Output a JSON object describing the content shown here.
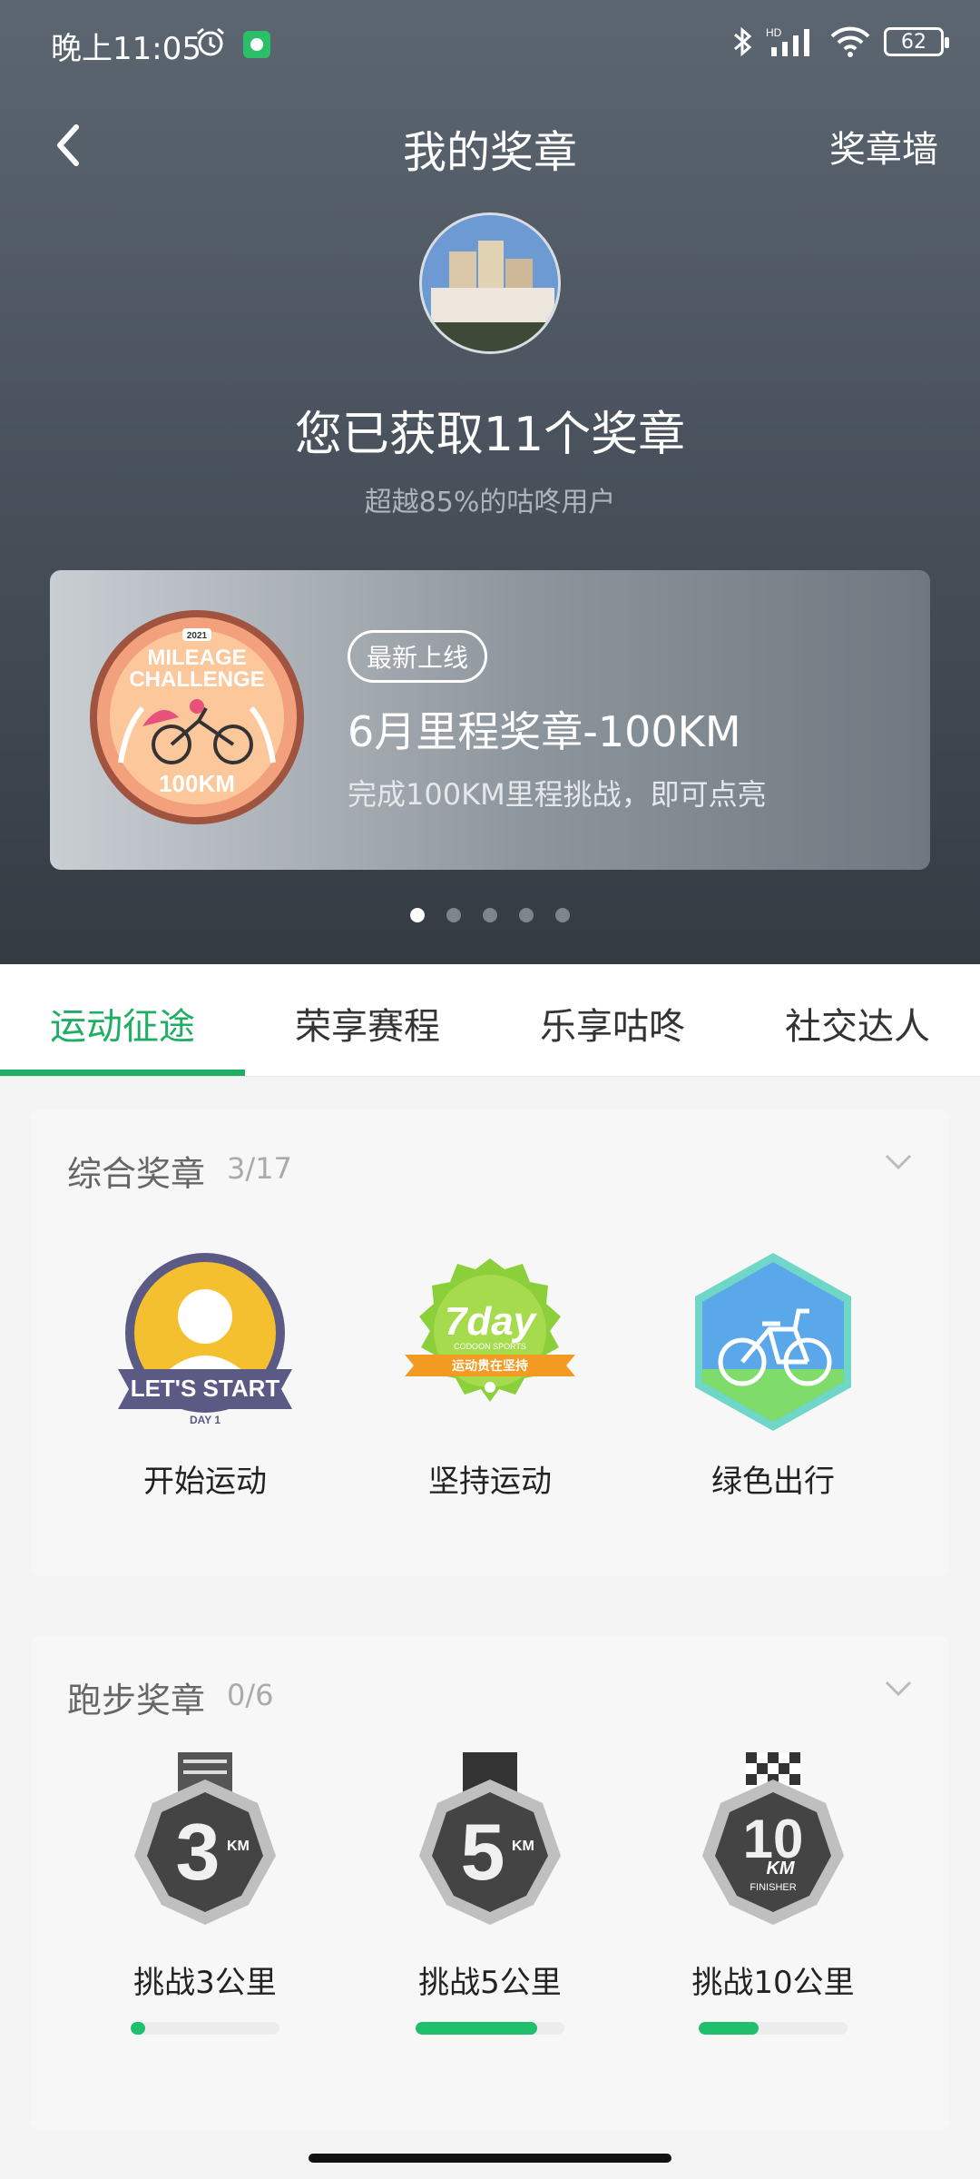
{
  "status_bar": {
    "time": "晚上11:05",
    "battery": "62",
    "hd": "HD"
  },
  "nav": {
    "title": "我的奖章",
    "right_action": "奖章墙"
  },
  "summary": {
    "heading": "您已获取11个奖章",
    "subheading": "超越85%的咕咚用户"
  },
  "banner": {
    "tag": "最新上线",
    "title": "6月里程奖章-100KM",
    "description": "完成100KM里程挑战，即可点亮",
    "medal_text": {
      "year": "2021",
      "line1": "MILEAGE",
      "line2": "CHALLENGE",
      "distance": "100KM"
    }
  },
  "carousel": {
    "count": 5,
    "active": 0
  },
  "tabs": [
    "运动征途",
    "荣享赛程",
    "乐享咕咚",
    "社交达人"
  ],
  "active_tab": 0,
  "sections": [
    {
      "title": "综合奖章",
      "count": "3/17",
      "badges": [
        {
          "label": "开始运动",
          "art": {
            "line1": "LET'S START",
            "line2": "DAY 1"
          }
        },
        {
          "label": "坚持运动",
          "art": {
            "line1": "7day",
            "line2": "CODOON SPORTS",
            "line3": "运动贵在坚持"
          }
        },
        {
          "label": "绿色出行"
        }
      ]
    },
    {
      "title": "跑步奖章",
      "count": "0/6",
      "badges": [
        {
          "label": "挑战3公里",
          "progress": 0.1,
          "art": {
            "num": "3",
            "unit": "KM"
          }
        },
        {
          "label": "挑战5公里",
          "progress": 0.82,
          "art": {
            "num": "5",
            "unit": "KM"
          }
        },
        {
          "label": "挑战10公里",
          "progress": 0.4,
          "art": {
            "num": "10",
            "unit": "KM",
            "sub": "FINISHER"
          }
        }
      ]
    }
  ],
  "colors": {
    "accent": "#1fae63",
    "progress": "#1fbf6e",
    "hero_top": "#5c6671",
    "hero_bottom": "#343b43"
  }
}
